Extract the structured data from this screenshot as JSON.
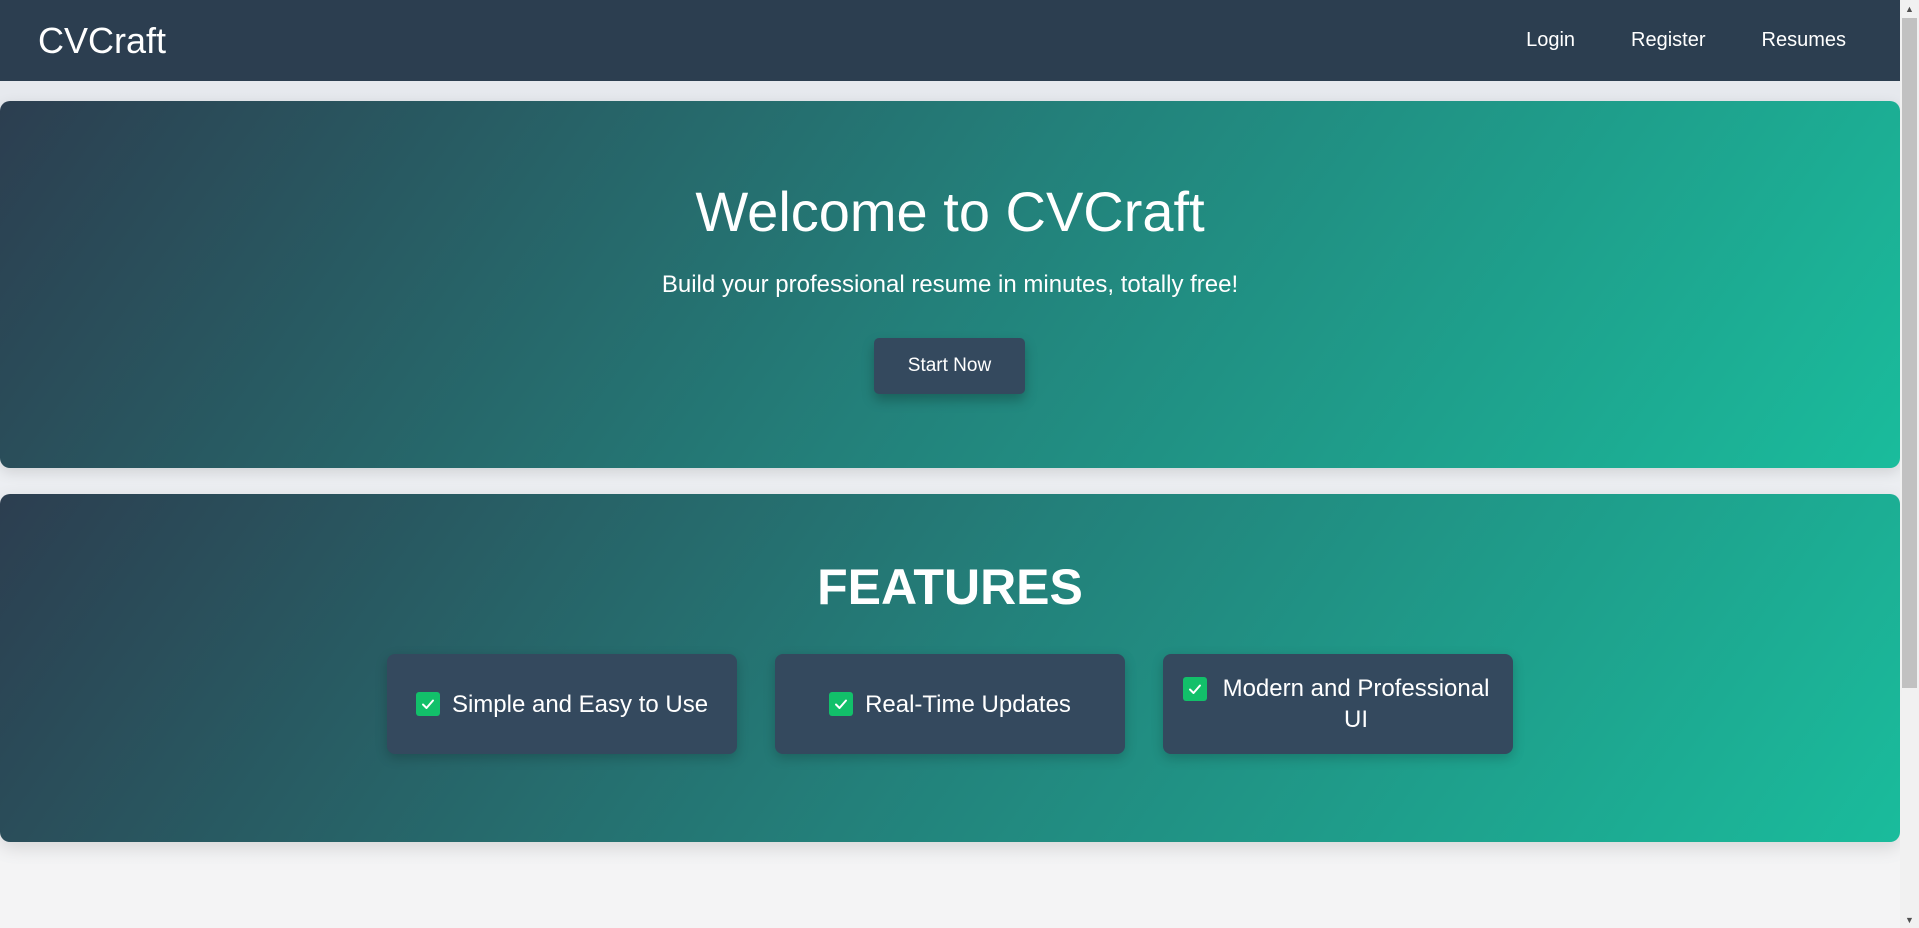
{
  "app": {
    "brand": "CVCraft"
  },
  "nav": {
    "items": [
      {
        "label": "Login"
      },
      {
        "label": "Register"
      },
      {
        "label": "Resumes"
      }
    ]
  },
  "hero": {
    "title": "Welcome to CVCraft",
    "subtitle": "Build your professional resume in minutes, totally free!",
    "cta_label": "Start Now"
  },
  "features": {
    "title": "FEATURES",
    "items": [
      {
        "label": "Simple and Easy to Use",
        "icon": "check-box-icon"
      },
      {
        "label": "Real-Time Updates",
        "icon": "check-box-icon"
      },
      {
        "label": "Modern and Professional UI",
        "icon": "check-box-icon"
      }
    ]
  },
  "colors": {
    "navbar": "#2c3e50",
    "gradient_start": "#2c3e50",
    "gradient_end": "#1abc9c",
    "button": "#34495e",
    "check": "#12c06a"
  }
}
